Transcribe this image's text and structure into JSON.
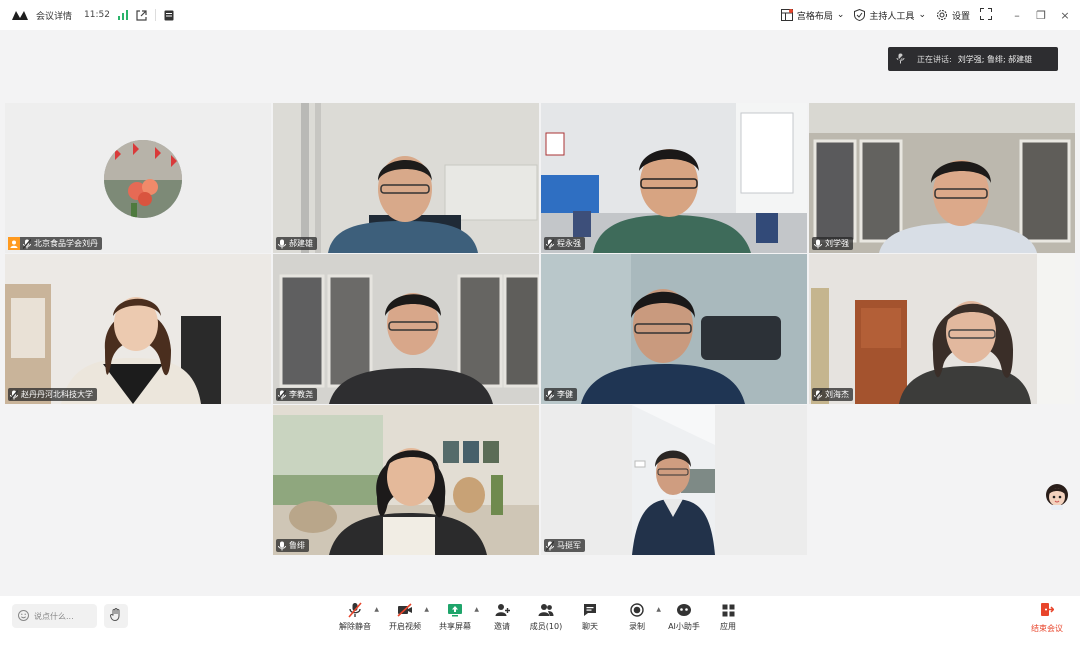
{
  "topbar": {
    "title": "会议详情",
    "time": "11:52",
    "layout_label": "宫格布局",
    "host_tools_label": "主持人工具",
    "settings_label": "设置"
  },
  "speaking": {
    "label": "正在讲话:",
    "names": "刘学强; 鲁绯; 郝建雄"
  },
  "participants": [
    {
      "name": "北京食品学会刘丹",
      "host": true,
      "video": false
    },
    {
      "name": "郝建雄",
      "host": false,
      "video": true
    },
    {
      "name": "程永强",
      "host": false,
      "video": true
    },
    {
      "name": "刘学强",
      "host": false,
      "video": true,
      "active": true
    },
    {
      "name": "赵丹丹河北科技大学",
      "host": false,
      "video": true
    },
    {
      "name": "李教尧",
      "host": false,
      "video": true
    },
    {
      "name": "李健",
      "host": false,
      "video": true
    },
    {
      "name": "刘海杰",
      "host": false,
      "video": true
    },
    {
      "name": "鲁绯",
      "host": false,
      "video": true
    },
    {
      "name": "马挺军",
      "host": false,
      "video": true
    }
  ],
  "bottombar": {
    "chat_placeholder": "说点什么...",
    "tools": [
      {
        "label": "解除静音",
        "icon": "mic-muted-icon"
      },
      {
        "label": "开启视频",
        "icon": "camera-off-icon"
      },
      {
        "label": "共享屏幕",
        "icon": "share-screen-icon"
      },
      {
        "label": "邀请",
        "icon": "invite-icon"
      },
      {
        "label": "成员(10)",
        "icon": "members-icon"
      },
      {
        "label": "聊天",
        "icon": "chat-icon"
      },
      {
        "label": "录制",
        "icon": "record-icon"
      },
      {
        "label": "AI小助手",
        "icon": "ai-assistant-icon"
      },
      {
        "label": "应用",
        "icon": "apps-icon"
      }
    ],
    "end_label": "结束会议"
  },
  "colors": {
    "accent_green": "#4cc28f",
    "host_orange": "#ff9a1f",
    "end_red": "#e8452b",
    "share_green": "#1fa56b"
  }
}
